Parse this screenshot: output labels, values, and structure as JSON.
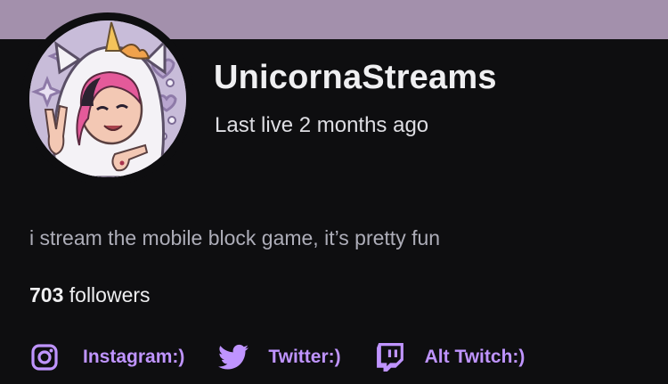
{
  "colors": {
    "banner": "#a390ac",
    "background": "#0e0e10",
    "accent": "#bf94ff",
    "text": "#efeff1",
    "muted": "#adadb8"
  },
  "channel": {
    "name": "UnicornaStreams",
    "last_live": "Last live 2 months ago",
    "bio": "i stream the mobile block game, it’s pretty fun",
    "followers_count": "703",
    "followers_label": " followers"
  },
  "links": [
    {
      "icon": "instagram-icon",
      "label": "Instagram:)"
    },
    {
      "icon": "twitter-icon",
      "label": "Twitter:)"
    },
    {
      "icon": "twitch-icon",
      "label": "Alt Twitch:)"
    }
  ]
}
